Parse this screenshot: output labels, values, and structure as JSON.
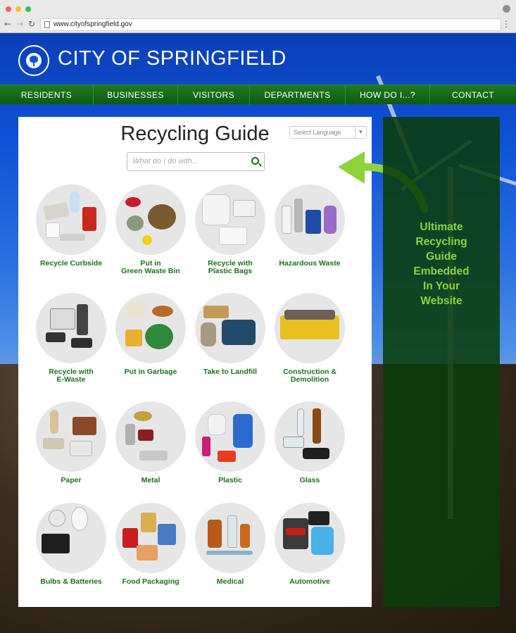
{
  "browser": {
    "url": "www.cityofspringfield.gov",
    "back": "←",
    "forward": "→",
    "reload": "↻",
    "menu": "⋮"
  },
  "header": {
    "title": "CITY OF SPRINGFIELD",
    "logo_icon": "city-seal-icon"
  },
  "nav": {
    "items": [
      {
        "label": "RESIDENTS"
      },
      {
        "label": "BUSINESSES"
      },
      {
        "label": "VISITORS"
      },
      {
        "label": "DEPARTMENTS"
      },
      {
        "label": "HOW DO I...?"
      },
      {
        "label": "CONTACT"
      }
    ]
  },
  "guide": {
    "title": "Recycling Guide",
    "language_placeholder": "Select Language",
    "search_placeholder": "What do I do with..."
  },
  "categories": [
    {
      "line1": "Recycle Curbside",
      "line2": ""
    },
    {
      "line1": "Put in",
      "line2": "Green Waste Bin"
    },
    {
      "line1": "Recycle with",
      "line2": "Plastic Bags"
    },
    {
      "line1": "Hazardous Waste",
      "line2": ""
    },
    {
      "line1": "Recycle with",
      "line2": "E-Waste"
    },
    {
      "line1": "Put in Garbage",
      "line2": ""
    },
    {
      "line1": "Take to Landfill",
      "line2": ""
    },
    {
      "line1": "Construction &",
      "line2": "Demolition"
    },
    {
      "line1": "Paper",
      "line2": ""
    },
    {
      "line1": "Metal",
      "line2": ""
    },
    {
      "line1": "Plastic",
      "line2": ""
    },
    {
      "line1": "Glass",
      "line2": ""
    },
    {
      "line1": "Bulbs & Batteries",
      "line2": ""
    },
    {
      "line1": "Food Packaging",
      "line2": ""
    },
    {
      "line1": "Medical",
      "line2": ""
    },
    {
      "line1": "Automotive",
      "line2": ""
    }
  ],
  "promo": {
    "lines": [
      "Ultimate",
      "Recycling",
      "Guide",
      "Embedded",
      "In Your",
      "Website"
    ]
  },
  "colors": {
    "nav_green": "#0d5a12",
    "label_green": "#1f6f1f",
    "promo_green": "#8ed33c",
    "sky_blue": "#0f52d4"
  }
}
